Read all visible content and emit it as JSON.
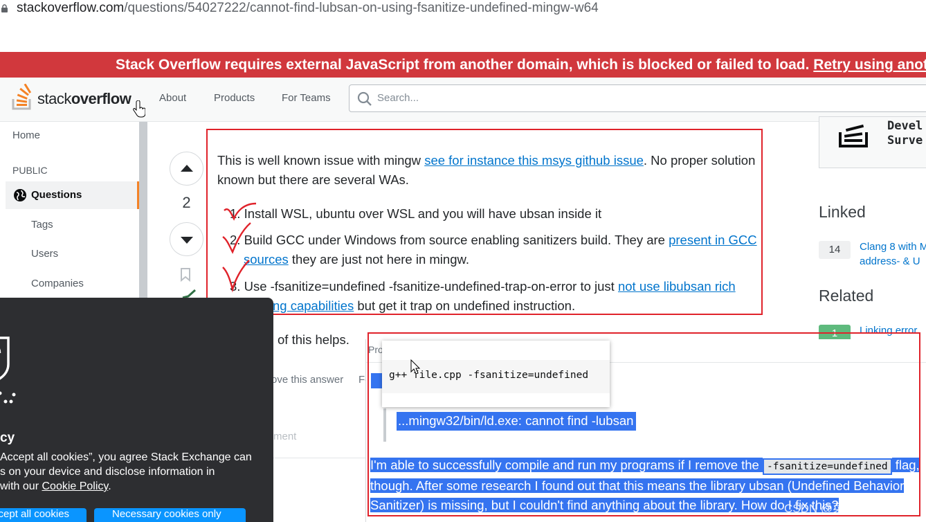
{
  "browser": {
    "url_domain": "stackoverflow.com",
    "url_path": "/questions/54027222/cannot-find-lubsan-on-using-fsanitize-undefined-mingw-w64"
  },
  "banner": {
    "text": "Stack Overflow requires external JavaScript from another domain, which is blocked or failed to load.",
    "link": "Retry using anothe"
  },
  "topbar": {
    "logo_text_light": "stack",
    "logo_text_bold": "overflow",
    "nav": [
      "About",
      "Products",
      "For Teams"
    ],
    "search_placeholder": "Search..."
  },
  "leftnav": {
    "home": "Home",
    "section": "PUBLIC",
    "questions": "Questions",
    "tags": "Tags",
    "users": "Users",
    "companies": "Companies"
  },
  "answer": {
    "votes": "2",
    "intro_1": "This is well known issue with mingw",
    "intro_link": "see for instance this msys github issue",
    "intro_2": ". No proper solution",
    "intro_3": "known but there are several WAs.",
    "items": [
      {
        "num": "1.",
        "text": "Install WSL, ubuntu over WSL and you will have ubsan inside it"
      },
      {
        "num": "2.",
        "text_a": "Build GCC under Windows from source enabling sanitizers build. They are",
        "link_a": "present in GCC",
        "link_b": "sources",
        "text_b": "they are just not here in mingw."
      },
      {
        "num": "3.",
        "text_a": "Use -fsanitize=undefined -fsanitize-undefined-trap-on-error to just",
        "link_a": "not use libubsan rich",
        "link_b": "ng capabilities",
        "text_b": "but get it trap on undefined instruction."
      }
    ],
    "closing": "of this helps.",
    "improve": "rove this answer",
    "comment": "ment",
    "fol": "Fol"
  },
  "right_sidebar": {
    "survey_line1": "Devel",
    "survey_line2": "Surve",
    "linked_heading": "Linked",
    "linked_count": "14",
    "linked_line1": "Clang 8 with M",
    "linked_line2": "address- & U",
    "related_heading": "Related",
    "related_count": "1",
    "related_link": "Linking error"
  },
  "cookie": {
    "title": "cy",
    "line1": "Accept all cookies”, you agree Stack Exchange can",
    "line2": "s on your device and disclose information in",
    "line3": "with our",
    "policy_link": "Cookie Policy",
    "line3_end": ".",
    "btn1": "Accept all cookies",
    "btn2": "Necessary cookies only"
  },
  "overlay": {
    "pro": "Pro",
    "tooltip_code": "g++ file.cpp -fsanitize=undefined",
    "error_line": "...mingw32/bin/ld.exe: cannot find -lubsan",
    "para_1": "I'm able to successfully compile and run my programs if I remove the",
    "inline_code": "-fsanitize=undefined",
    "para_1_end": "flag,",
    "para_2": "though. After some research I found out that this means the library ubsan (Undefined Behavior",
    "para_3": "Sanitizer) is missing, but I couldn't find anything about the library. How do I fix this?",
    "watermark": "CSDN @菜鸟磊代码"
  },
  "colors": {
    "banner_bg": "#d1383d",
    "link": "#0074cc",
    "selection": "#3574f0",
    "annotation_red": "#e0222a",
    "so_orange": "#f48225"
  }
}
